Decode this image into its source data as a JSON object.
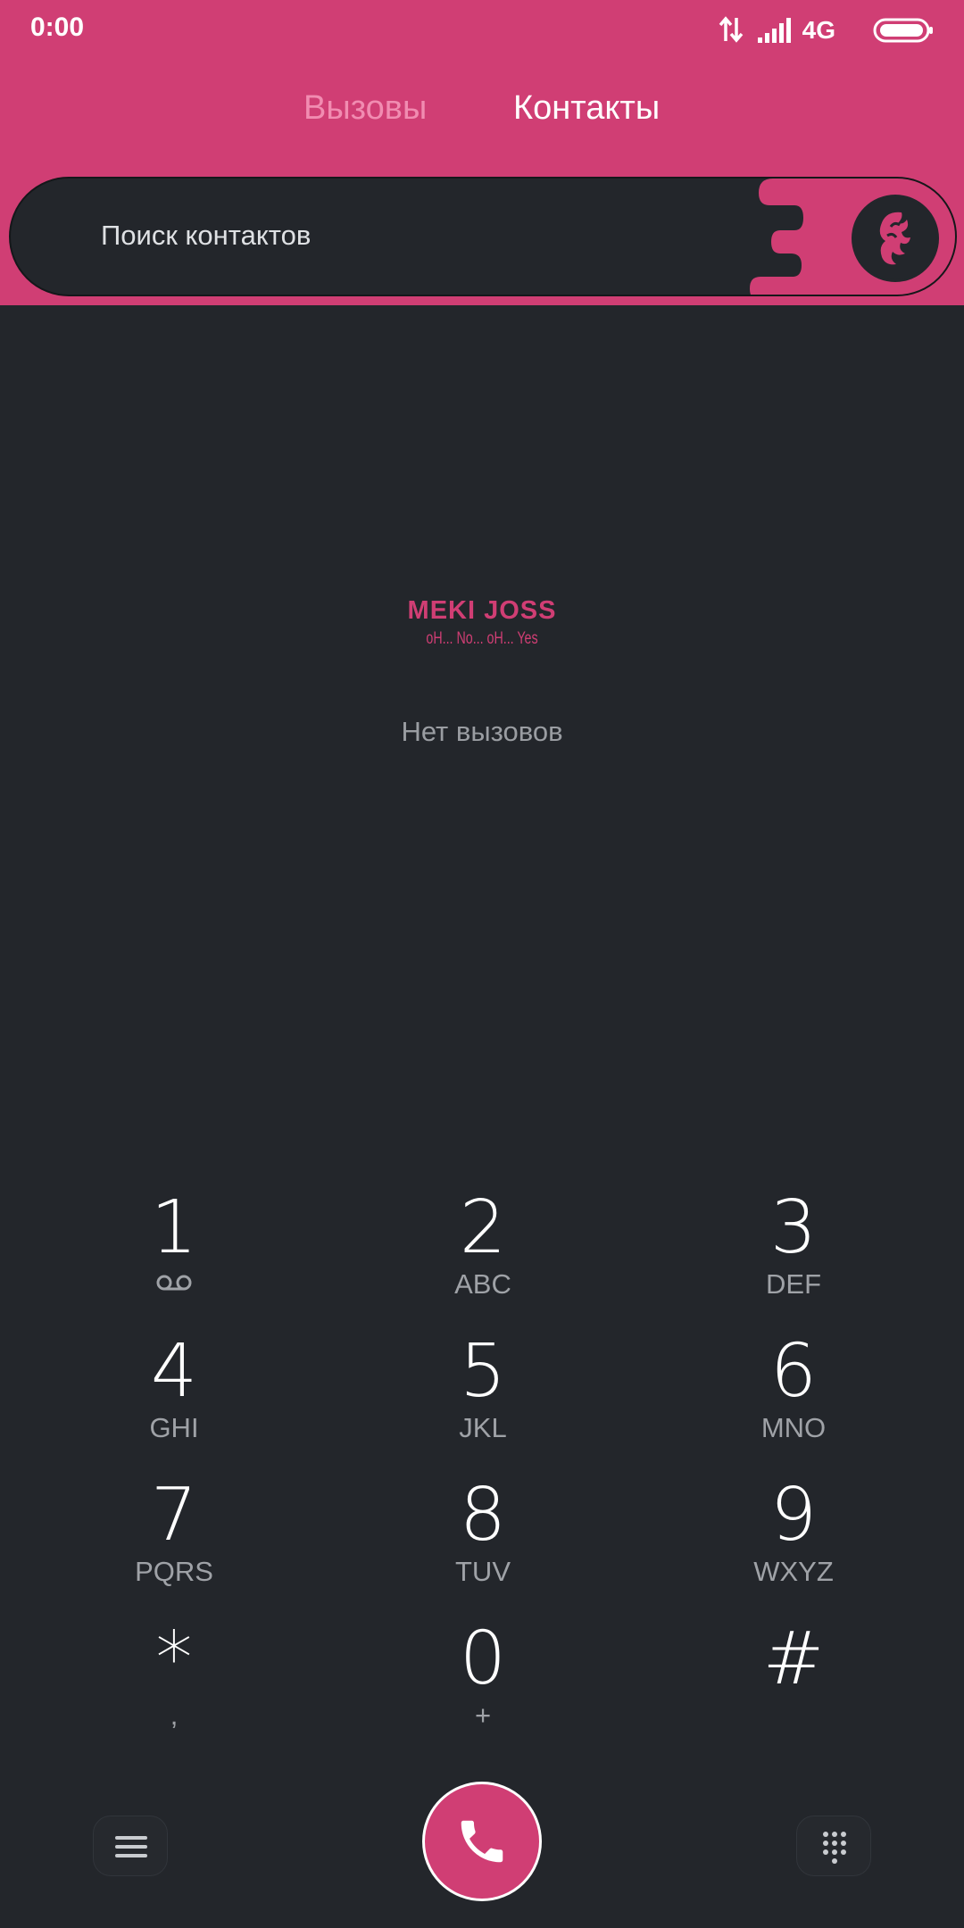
{
  "status_bar": {
    "time": "0:00",
    "network": "4G",
    "icons": [
      "data-arrows-icon",
      "signal-icon",
      "battery-icon"
    ]
  },
  "tabs": [
    {
      "label": "Вызовы",
      "active": false
    },
    {
      "label": "Контакты",
      "active": true
    }
  ],
  "search": {
    "placeholder": "Поиск контактов",
    "avatar_icon": "avatar-icon"
  },
  "brand": {
    "title": "MEKI JOSS",
    "subtitle": "oH... No... oH... Yes"
  },
  "empty_state": {
    "text": "Нет вызовов"
  },
  "dialpad": {
    "keys": [
      {
        "digit": "1",
        "letters": "",
        "icon": "voicemail-icon"
      },
      {
        "digit": "2",
        "letters": "ABC"
      },
      {
        "digit": "3",
        "letters": "DEF"
      },
      {
        "digit": "4",
        "letters": "GHI"
      },
      {
        "digit": "5",
        "letters": "JKL"
      },
      {
        "digit": "6",
        "letters": "MNO"
      },
      {
        "digit": "7",
        "letters": "PQRS"
      },
      {
        "digit": "8",
        "letters": "TUV"
      },
      {
        "digit": "9",
        "letters": "WXYZ"
      },
      {
        "digit": "*",
        "letters": ","
      },
      {
        "digit": "0",
        "letters": "+"
      },
      {
        "digit": "#",
        "letters": ""
      }
    ]
  },
  "bottom_bar": {
    "left_icon": "menu-icon",
    "center_icon": "phone-icon",
    "right_icon": "dialpad-icon"
  },
  "colors": {
    "accent": "#d03e74",
    "background": "#23262b",
    "accent_light": "#f18cb1",
    "text_primary": "#ffffff",
    "text_secondary": "#9fa2a7"
  }
}
